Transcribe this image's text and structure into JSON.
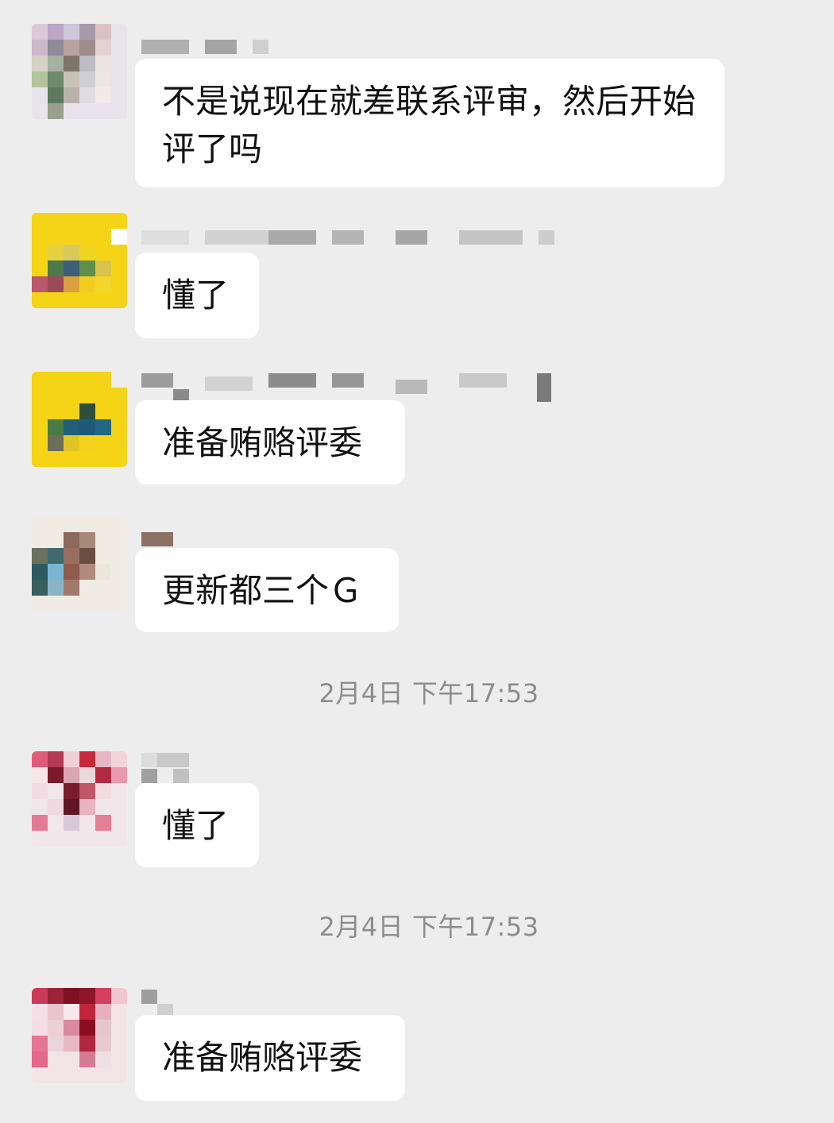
{
  "messages": [
    {
      "text": "不是说现在就差联系评审，然后开始评了吗"
    },
    {
      "text": "懂了"
    },
    {
      "text": "准备贿赂评委"
    },
    {
      "text": "更新都三个Ｇ"
    },
    {
      "text": "懂了"
    },
    {
      "text": "准备贿赂评委"
    }
  ],
  "timestamps": [
    {
      "text": "2月4日 下午17:53"
    },
    {
      "text": "2月4日 下午17:53"
    }
  ],
  "colors": {
    "background": "#ededed",
    "bubble": "#ffffff",
    "timestamp": "#8c8c8c"
  }
}
